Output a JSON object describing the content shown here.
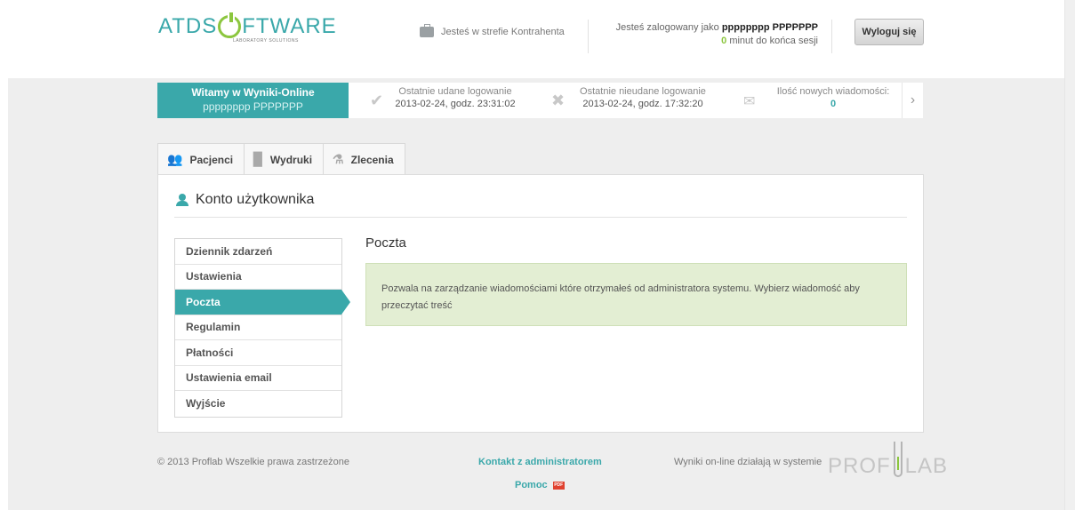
{
  "header": {
    "logo_left": "ATDS",
    "logo_right": "FTWARE",
    "logo_subtitle": "LABORATORY SOLUTIONS",
    "zone_text": "Jesteś w strefie Kontrahenta",
    "logged_as_label": "Jesteś zalogowany jako",
    "logged_user": "pppppppp PPPPPPP",
    "session_minutes": "0",
    "session_suffix": "minut do końca sesji",
    "logout_label": "Wyloguj się"
  },
  "info_bar": {
    "welcome_title": "Witamy w Wyniki-Online",
    "welcome_user": "pppppppp PPPPPPP",
    "last_success_label": "Ostatnie udane logowanie",
    "last_success_value": "2013-02-24, godz. 23:31:02",
    "last_fail_label": "Ostatnie nieudane logowanie",
    "last_fail_value": "2013-02-24, godz. 17:32:20",
    "new_messages_label": "Ilość nowych wiadomości:",
    "new_messages_value": "0"
  },
  "tabs": [
    {
      "label": "Pacjenci",
      "icon": "users-icon"
    },
    {
      "label": "Wydruki",
      "icon": "document-icon"
    },
    {
      "label": "Zlecenia",
      "icon": "flask-icon"
    }
  ],
  "account": {
    "title": "Konto użytkownika"
  },
  "menu": {
    "items": [
      {
        "label": "Dziennik zdarzeń",
        "active": false
      },
      {
        "label": "Ustawienia",
        "active": false
      },
      {
        "label": "Poczta",
        "active": true
      },
      {
        "label": "Regulamin",
        "active": false
      },
      {
        "label": "Płatności",
        "active": false
      },
      {
        "label": "Ustawienia email",
        "active": false
      },
      {
        "label": "Wyjście",
        "active": false
      }
    ]
  },
  "content": {
    "title": "Poczta",
    "notice": "Pozwala na zarządzanie wiadomościami które otrzymałeś od administratora systemu. Wybierz wiadomość aby przeczytać treść"
  },
  "footer": {
    "copyright": "© 2013 Proflab Wszelkie prawa zastrzeżone",
    "contact_label": "Kontakt z administratorem",
    "help_label": "Pomoc",
    "pdf_badge": "PDF",
    "powered_text": "Wyniki on-line działają w systemie",
    "brand_left": "PROF",
    "brand_right": "LAB"
  },
  "colors": {
    "accent": "#3aa8aa",
    "green": "#8cc63f",
    "notice_bg": "#e3eed3"
  }
}
